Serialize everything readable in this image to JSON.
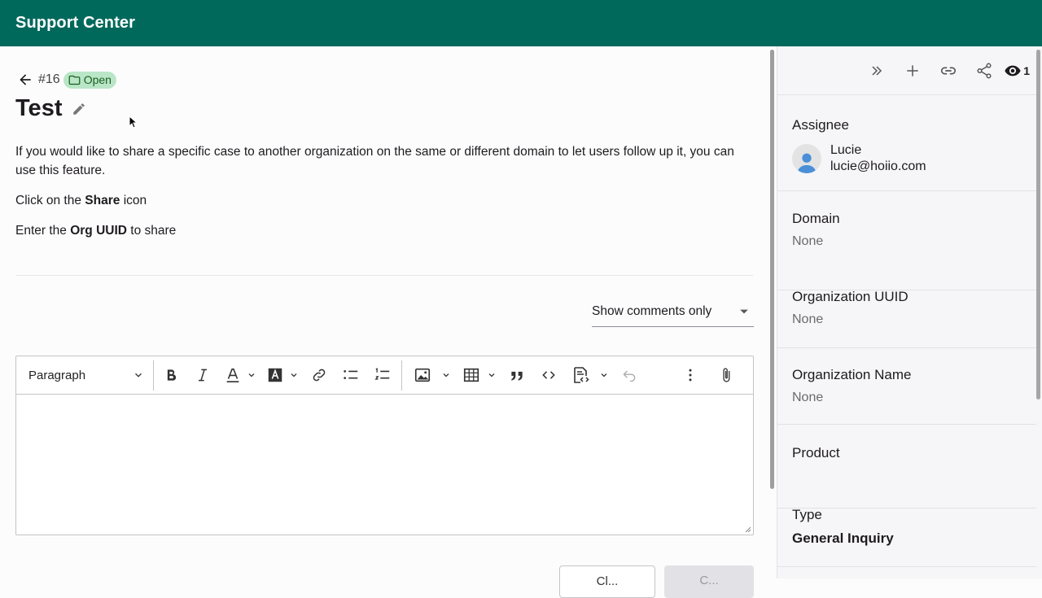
{
  "app": {
    "title": "Support Center"
  },
  "case": {
    "number": "#16",
    "status": "Open",
    "title": "Test",
    "description": [
      {
        "parts": [
          {
            "text": "If you would like to share a specific case to another organization on the same or different domain to let users follow up it, you can use this feature.",
            "bold": false
          }
        ]
      },
      {
        "parts": [
          {
            "text": "Click on the ",
            "bold": false
          },
          {
            "text": "Share",
            "bold": true
          },
          {
            "text": " icon",
            "bold": false
          }
        ]
      },
      {
        "parts": [
          {
            "text": "Enter the ",
            "bold": false
          },
          {
            "text": "Org UUID",
            "bold": true
          },
          {
            "text": " to share",
            "bold": false
          }
        ]
      }
    ]
  },
  "comments": {
    "filter_value": "Show comments only"
  },
  "editor": {
    "paragraph_label": "Paragraph",
    "tools": [
      "bold-icon",
      "italic-icon",
      "font-color-icon",
      "font-background-icon",
      "link-icon",
      "bulleted-list-icon",
      "numbered-list-icon",
      "image-icon",
      "table-icon",
      "blockquote-icon",
      "code-icon",
      "code-block-icon",
      "undo-icon",
      "more-icon",
      "attachment-icon"
    ]
  },
  "actions": {
    "cancel_label": "Cl...",
    "submit_label": "C..."
  },
  "sidebar": {
    "watchers_count": "1",
    "assignee_label": "Assignee",
    "assignee_name": "Lucie",
    "assignee_email": "lucie@hoiio.com",
    "domain_label": "Domain",
    "domain_value": "None",
    "org_uuid_label": "Organization UUID",
    "org_uuid_value": "None",
    "org_name_label": "Organization Name",
    "org_name_value": "None",
    "product_label": "Product",
    "type_label": "Type",
    "type_value": "General Inquiry"
  },
  "colors": {
    "brand": "#00695c",
    "badge_bg": "#b9e6c6",
    "badge_text": "#1b5e20"
  }
}
